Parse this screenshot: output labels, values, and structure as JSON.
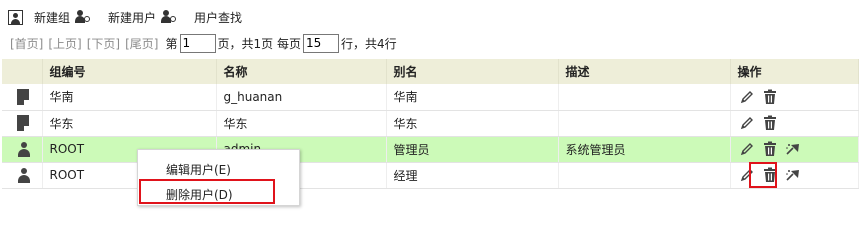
{
  "toolbar": {
    "new_group_label": "新建组",
    "new_user_label": "新建用户",
    "find_user_label": "用户查找"
  },
  "pager": {
    "first": "[首页]",
    "prev": "[上页]",
    "next": "[下页]",
    "last": "[尾页]",
    "page_prefix": "第",
    "page_value": "1",
    "page_suffix": "页，共1页 每页",
    "per_page_value": "15",
    "rows_suffix": "行，共4行"
  },
  "table": {
    "headers": [
      "组编号",
      "名称",
      "别名",
      "描述",
      "操作"
    ],
    "rows": [
      {
        "type": "group",
        "id": "华南",
        "name": "g_huanan",
        "alias": "华南",
        "desc": ""
      },
      {
        "type": "group",
        "id": "华东",
        "name": "华东",
        "alias": "华东",
        "desc": ""
      },
      {
        "type": "user",
        "id": "ROOT",
        "name": "admin",
        "alias": "管理员",
        "desc": "系统管理员"
      },
      {
        "type": "user",
        "id": "ROOT",
        "name": "",
        "alias": "经理",
        "desc": ""
      }
    ]
  },
  "context_menu": {
    "edit_label": "编辑用户(E)",
    "delete_label": "删除用户(D)"
  },
  "colors": {
    "header_bg": "#eeeed9",
    "selected_row_bg": "#ccfab8",
    "highlight_border": "#e0131b"
  }
}
